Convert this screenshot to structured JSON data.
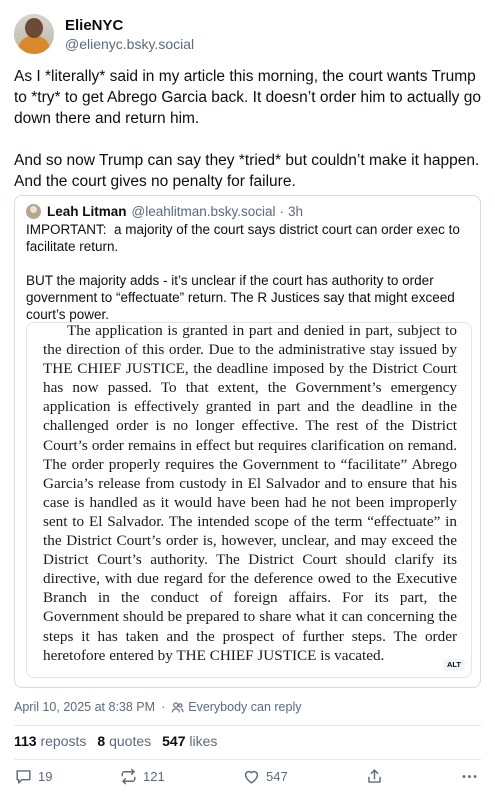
{
  "author": {
    "display_name": "ElieNYC",
    "handle": "@elienyc.bsky.social"
  },
  "post": {
    "text": "As I *literally* said in my article this morning, the court wants Trump to *try* to get Abrego Garcia back. It doesn’t order him to actually go down there and return him.\n\nAnd so now Trump can say they *tried* but couldn’t make it happen. And the court gives no penalty for failure."
  },
  "quote": {
    "display_name": "Leah Litman",
    "handle": "@leahlitman.bsky.social",
    "separator": "·",
    "time": "3h",
    "text": "IMPORTANT:  a majority of the court says district court can order exec to facilitate return.\n\nBUT the majority adds - it’s unclear if the court has authority to order government to “effectuate” return. The R Justices say that might exceed court’s power.",
    "image_text": "The application is granted in part and denied in part, subject to the direction of this order.  Due to the administrative stay issued by THE CHIEF JUSTICE, the deadline imposed by the District Court has now passed.  To that extent, the Government’s emergency application is effectively granted in part and the deadline in the challenged order is no longer effective.  The rest of the District Court’s order remains in effect but requires clarification on remand.  The order properly requires the Government to “facilitate” Abrego Garcia’s release from custody in El Salvador and to ensure that his case is handled as it would have been had he not been improperly sent to El Salvador.  The intended scope of the term “effectuate” in the District Court’s order is, however, unclear, and may exceed the District Court’s authority.  The District Court should clarify its directive, with due regard for the deference owed to the Executive Branch in the conduct of foreign affairs.  For its part, the Government should be prepared to share what it can concerning the steps it has taken and the prospect of further steps.  The order heretofore entered by THE CHIEF JUSTICE is vacated.",
    "alt_label": "ALT"
  },
  "meta": {
    "timestamp": "April 10, 2025 at 8:38 PM",
    "separator": "·",
    "reply_setting": "Everybody can reply"
  },
  "stats": {
    "reposts_count": "113",
    "reposts_label": "reposts",
    "quotes_count": "8",
    "quotes_label": "quotes",
    "likes_count": "547",
    "likes_label": "likes"
  },
  "actions": {
    "reply_count": "19",
    "repost_count": "121",
    "like_count": "547",
    "reply_icon": "reply-icon",
    "repost_icon": "repost-icon",
    "like_icon": "heart-icon",
    "share_icon": "share-icon",
    "more_icon": "more-icon"
  },
  "colors": {
    "text": "#0b0f14",
    "muted": "#5b6a7c",
    "border": "#d4dbe2"
  }
}
